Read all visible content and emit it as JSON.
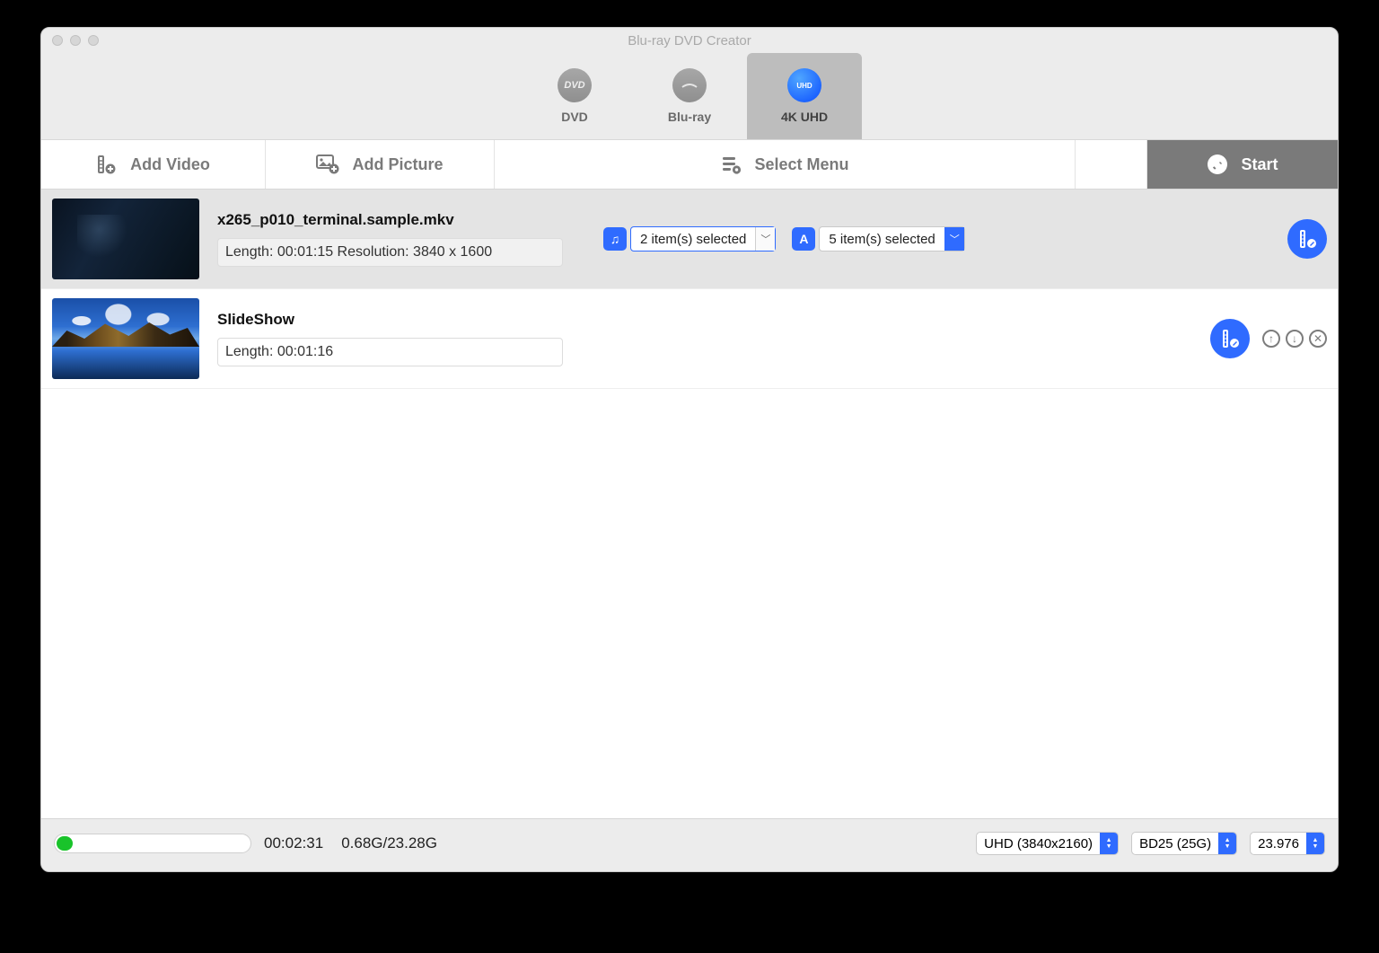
{
  "window": {
    "title": "Blu-ray DVD Creator"
  },
  "modes": {
    "dvd": {
      "label": "DVD",
      "icon_text": "DVD"
    },
    "bluray": {
      "label": "Blu-ray",
      "icon_text": ""
    },
    "uhd": {
      "label": "4K UHD",
      "icon_text": "UHD"
    },
    "active": "uhd"
  },
  "toolbar": {
    "add_video": "Add Video",
    "add_picture": "Add Picture",
    "select_menu": "Select Menu",
    "start": "Start"
  },
  "items": [
    {
      "name": "x265_p010_terminal.sample.mkv",
      "info": "Length: 00:01:15   Resolution: 3840 x 1600",
      "audio_select": "2 item(s) selected",
      "sub_select": "5 item(s) selected",
      "selected": true,
      "thumb_style": "dark",
      "show_mini_actions": false
    },
    {
      "name": "SlideShow",
      "info": "Length: 00:01:16",
      "audio_select": "",
      "sub_select": "",
      "selected": false,
      "thumb_style": "landscape",
      "show_mini_actions": true
    }
  ],
  "footer": {
    "duration": "00:02:31",
    "size": "0.68G/23.28G",
    "resolution": "UHD (3840x2160)",
    "disc": "BD25 (25G)",
    "fps": "23.976",
    "progress_percent": 3
  },
  "colors": {
    "accent": "#2f6bff",
    "toolbar_dark": "#7a7a7a"
  }
}
